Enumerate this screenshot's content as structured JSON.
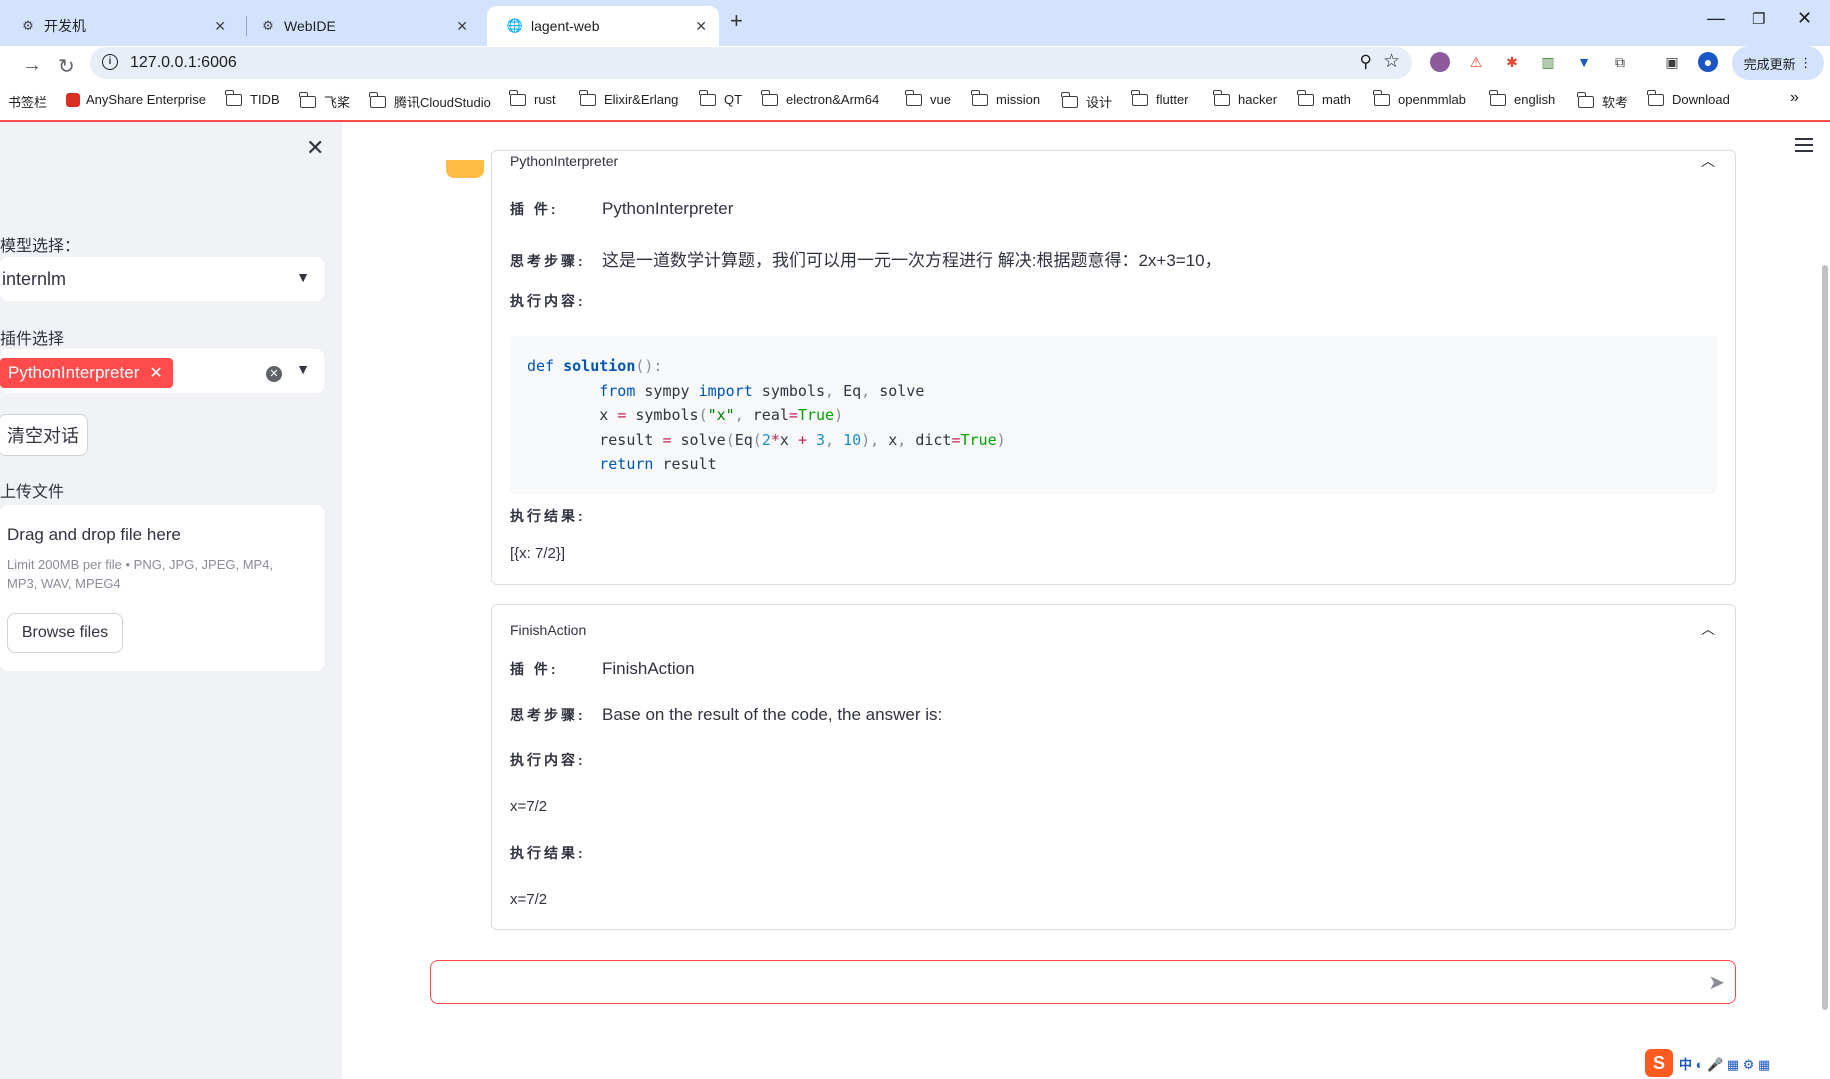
{
  "browser": {
    "tabs": [
      {
        "title": "开发机"
      },
      {
        "title": "WebIDE"
      },
      {
        "title": "lagent-web"
      }
    ],
    "url": "127.0.0.1:6006",
    "update_button": "完成更新",
    "bookmarks": [
      "书签栏",
      "AnyShare Enterprise",
      "TIDB",
      "飞桨",
      "腾讯CloudStudio",
      "rust",
      "Elixir&Erlang",
      "QT",
      "electron&Arm64",
      "vue",
      "mission",
      "设计",
      "flutter",
      "hacker",
      "math",
      "openmmlab",
      "english",
      "软考",
      "Download"
    ]
  },
  "sidebar": {
    "model_label": "模型选择：",
    "model_value": "internlm",
    "plugin_label": "插件选择",
    "plugin_tag": "PythonInterpreter",
    "clear_button": "清空对话",
    "upload_label": "上传文件",
    "upload_title": "Drag and drop file here",
    "upload_limit": "Limit 200MB per file • PNG, JPG, JPEG, MP4, MP3, WAV, MPEG4",
    "browse_button": "Browse files"
  },
  "labels": {
    "plugin": "插 件:",
    "thought": "思考步骤:",
    "exec_content": "执行内容:",
    "exec_result": "执行结果:"
  },
  "cards": [
    {
      "title": "PythonInterpreter",
      "plugin": "PythonInterpreter",
      "thought": "这是一道数学计算题，我们可以用一元一次方程进行 解决:根据题意得：2x+3=10，",
      "result": "[{x: 7/2}]"
    },
    {
      "title": "FinishAction",
      "plugin": "FinishAction",
      "thought": "Base on the result of the code, the answer is:",
      "content": "x=7/2",
      "result": "x=7/2"
    }
  ],
  "chat_input": {
    "placeholder": ""
  }
}
